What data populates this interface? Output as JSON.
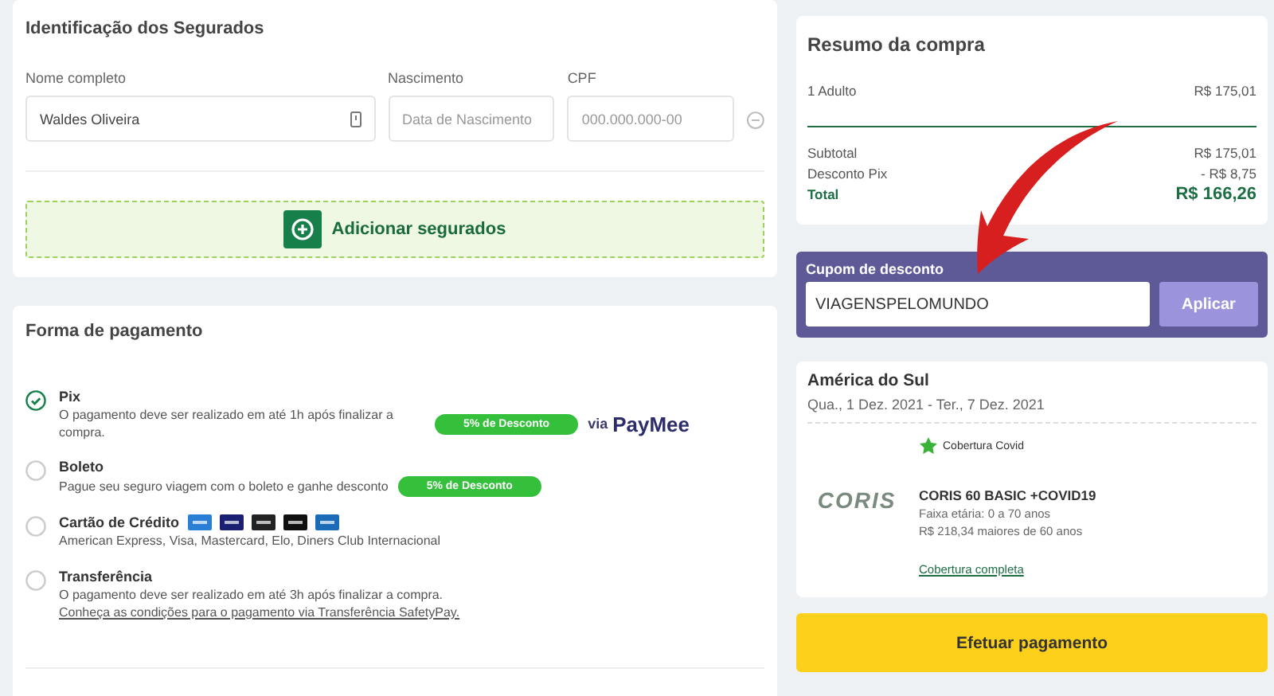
{
  "insured": {
    "title": "Identificação dos Segurados",
    "fields": [
      {
        "label": "Nome completo",
        "value": "Waldes Oliveira"
      },
      {
        "label": "Nascimento",
        "placeholder": "Data de Nascimento"
      },
      {
        "label": "CPF",
        "placeholder": "000.000.000-00"
      }
    ],
    "add_button": "Adicionar segurados"
  },
  "payment": {
    "title": "Forma de pagamento",
    "methods": [
      {
        "kind": "pix",
        "name": "Pix",
        "selected": true,
        "description": "O pagamento deve ser realizado em até 1h após finalizar a compra.",
        "badge": "5% de Desconto",
        "via": "via",
        "provider": "PayMee"
      },
      {
        "kind": "boleto",
        "name": "Boleto",
        "selected": false,
        "description": "Pague seu seguro viagem com o boleto e ganhe desconto",
        "badge": "5% de Desconto"
      },
      {
        "kind": "card",
        "name": "Cartão de Crédito",
        "selected": false,
        "description": "American Express, Visa, Mastercard, Elo, Diners Club Internacional"
      },
      {
        "kind": "transfer",
        "name": "Transferência",
        "selected": false,
        "description": "O pagamento deve ser realizado em até 3h após finalizar a compra.",
        "link": "Conheça as condições para o pagamento via Transferência SafetyPay."
      }
    ]
  },
  "summary": {
    "title": "Resumo da compra",
    "item": {
      "label": "1 Adulto",
      "value": "R$ 175,01"
    },
    "rows": [
      {
        "label": "Subtotal",
        "value": "R$ 175,01"
      },
      {
        "label": "Desconto Pix",
        "value": "- R$ 8,75"
      }
    ],
    "total": {
      "label": "Total",
      "value": "R$ 166,26"
    }
  },
  "coupon": {
    "label": "Cupom de desconto",
    "value": "VIAGENSPELOMUNDO",
    "button": "Aplicar"
  },
  "trip": {
    "destination": "América do Sul",
    "dates": "Qua., 1 Dez. 2021 - Ter., 7 Dez. 2021",
    "badge": "Cobertura Covid",
    "logo": "CORIS",
    "plan": "CORIS 60 BASIC +COVID19",
    "age_range": "Faixa etária: 0 a 70 anos",
    "senior_price": "R$ 218,34 maiores de 60 anos",
    "link": "Cobertura completa"
  },
  "pay_button": "Efetuar pagamento"
}
